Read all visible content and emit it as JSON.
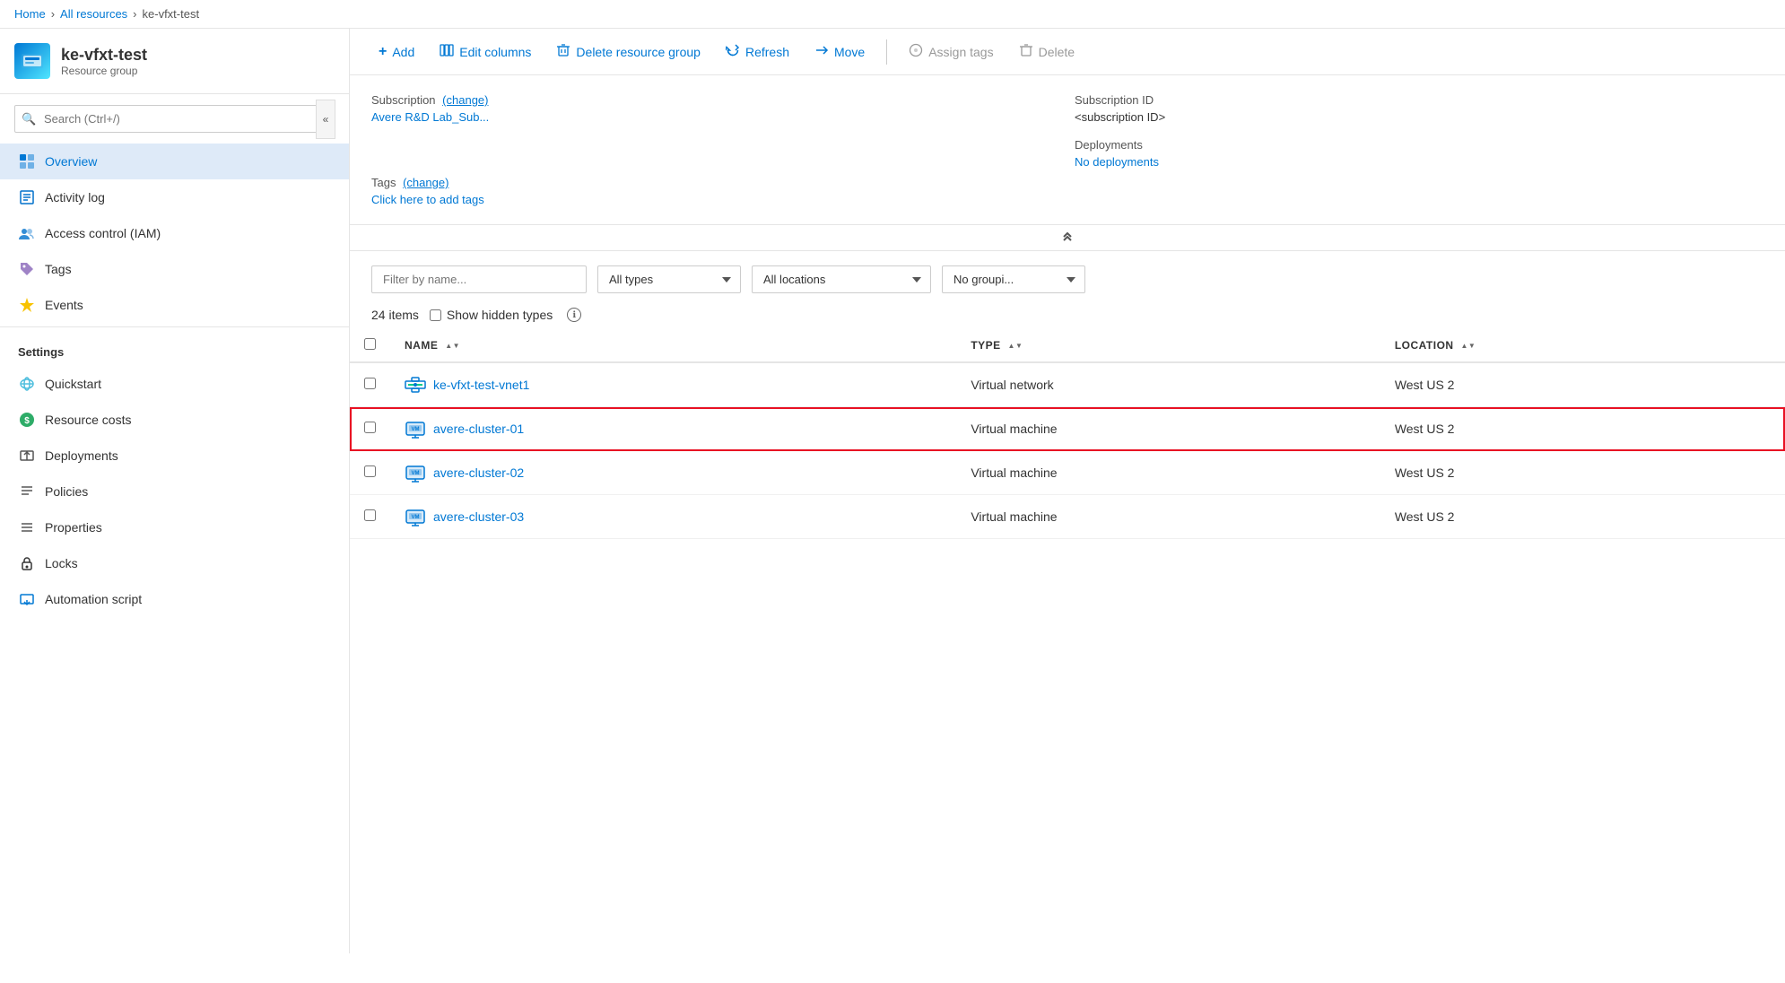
{
  "topbar": {
    "background": "#1a1a2e"
  },
  "breadcrumb": {
    "home": "Home",
    "all_resources": "All resources",
    "current": "ke-vfxt-test"
  },
  "sidebar": {
    "logo_icon": "⬡",
    "title": "ke-vfxt-test",
    "subtitle": "Resource group",
    "search_placeholder": "Search (Ctrl+/)",
    "nav_items": [
      {
        "id": "overview",
        "label": "Overview",
        "icon": "📋",
        "active": true
      },
      {
        "id": "activity-log",
        "label": "Activity log",
        "icon": "📄"
      },
      {
        "id": "iam",
        "label": "Access control (IAM)",
        "icon": "👥"
      },
      {
        "id": "tags",
        "label": "Tags",
        "icon": "🏷"
      },
      {
        "id": "events",
        "label": "Events",
        "icon": "⚡"
      }
    ],
    "settings_label": "Settings",
    "settings_items": [
      {
        "id": "quickstart",
        "label": "Quickstart",
        "icon": "☁"
      },
      {
        "id": "resource-costs",
        "label": "Resource costs",
        "icon": "💚"
      },
      {
        "id": "deployments",
        "label": "Deployments",
        "icon": "📤"
      },
      {
        "id": "policies",
        "label": "Policies",
        "icon": "☰"
      },
      {
        "id": "properties",
        "label": "Properties",
        "icon": "≡"
      },
      {
        "id": "locks",
        "label": "Locks",
        "icon": "🔒"
      },
      {
        "id": "automation-script",
        "label": "Automation script",
        "icon": "📥"
      }
    ]
  },
  "toolbar": {
    "add_label": "Add",
    "edit_columns_label": "Edit columns",
    "delete_group_label": "Delete resource group",
    "refresh_label": "Refresh",
    "move_label": "Move",
    "assign_tags_label": "Assign tags",
    "delete_label": "Delete"
  },
  "info_section": {
    "subscription_label": "Subscription",
    "subscription_change": "(change)",
    "subscription_value": "Avere R&D Lab_Sub...",
    "subscription_id_label": "Subscription ID",
    "subscription_id_value": "<subscription ID>",
    "deployments_label": "Deployments",
    "deployments_value": "No deployments",
    "tags_label": "Tags",
    "tags_change": "(change)",
    "tags_add": "Click here to add tags"
  },
  "filter_bar": {
    "filter_placeholder": "Filter by name...",
    "all_types_label": "All types",
    "all_locations_label": "All locations",
    "no_grouping_label": "No groupi...",
    "types_options": [
      "All types"
    ],
    "locations_options": [
      "All locations"
    ],
    "grouping_options": [
      "No groupi..."
    ]
  },
  "items_row": {
    "count": "24 items",
    "show_hidden_label": "Show hidden types"
  },
  "table": {
    "headers": [
      {
        "id": "name",
        "label": "NAME",
        "sortable": true
      },
      {
        "id": "type",
        "label": "TYPE",
        "sortable": true
      },
      {
        "id": "location",
        "label": "LOCATION",
        "sortable": true
      }
    ],
    "rows": [
      {
        "id": "row-1",
        "name": "ke-vfxt-test-vnet1",
        "type": "Virtual network",
        "location": "West US 2",
        "icon": "vnet",
        "selected": false,
        "highlighted": false
      },
      {
        "id": "row-2",
        "name": "avere-cluster-01",
        "type": "Virtual machine",
        "location": "West US 2",
        "icon": "vm",
        "selected": false,
        "highlighted": true
      },
      {
        "id": "row-3",
        "name": "avere-cluster-02",
        "type": "Virtual machine",
        "location": "West US 2",
        "icon": "vm",
        "selected": false,
        "highlighted": false
      },
      {
        "id": "row-4",
        "name": "avere-cluster-03",
        "type": "Virtual machine",
        "location": "West US 2",
        "icon": "vm",
        "selected": false,
        "highlighted": false
      }
    ]
  }
}
